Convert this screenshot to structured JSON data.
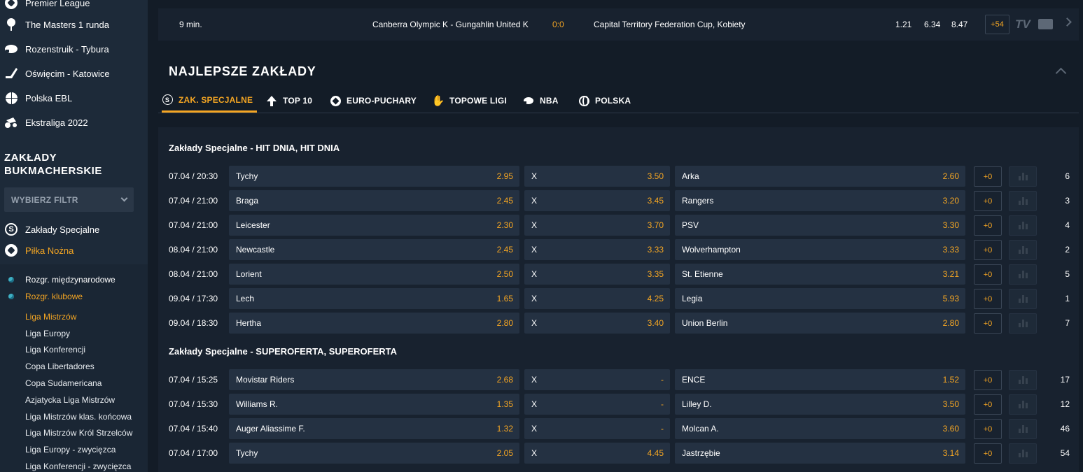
{
  "sidebar": {
    "top_items": [
      {
        "label": "Premier League",
        "icon": "soccer-ball-icon"
      },
      {
        "label": "The Masters 1 runda",
        "icon": "golf-icon"
      },
      {
        "label": "Rozenstruik - Tybura",
        "icon": "boxing-glove-icon"
      },
      {
        "label": "Oświęcim - Katowice",
        "icon": "hockey-stick-icon"
      },
      {
        "label": "Polska EBL",
        "icon": "basketball-icon"
      },
      {
        "label": "Ekstraliga 2022",
        "icon": "speedway-icon"
      }
    ],
    "heading": "ZAKŁADY BUKMACHERSKIE",
    "filter": {
      "label": "WYBIERZ FILTR"
    },
    "categories": [
      {
        "label": "Zakłady Specjalne",
        "icon": "special-s-icon"
      },
      {
        "label": "Piłka Nożna",
        "icon": "soccer-ball-icon"
      }
    ],
    "subcategories": [
      {
        "label": "Rozgr. międzynarodowe"
      },
      {
        "label": "Rozgr. klubowe"
      }
    ],
    "leagues": [
      "Liga Mistrzów",
      "Liga Europy",
      "Liga Konferencji",
      "Copa Libertadores",
      "Copa Sudamericana",
      "Azjatycka Liga Mistrzów",
      "Liga Mistrzów klas. końcowa",
      "Liga Mistrzów Król Strzelców",
      "Liga Europy - zwycięzca",
      "Liga Konferencji - zwycięzca"
    ]
  },
  "top_match": {
    "time": "9 min.",
    "teams": "Canberra Olympic K - Gungahlin United K",
    "score": "0:0",
    "competition": "Capital Territory Federation Cup, Kobiety",
    "odds": [
      "1.21",
      "6.34",
      "8.47"
    ],
    "more": "+54",
    "tv": "TV"
  },
  "section": {
    "title": "NAJLEPSZE ZAKŁADY"
  },
  "tabs": [
    {
      "label": "ZAK. SPECJALNE",
      "icon": "special-s-icon"
    },
    {
      "label": "TOP 10",
      "icon": "arrow-up-icon"
    },
    {
      "label": "EURO-PUCHARY",
      "icon": "soccer-ball-icon"
    },
    {
      "label": "TOPOWE LIGI",
      "icon": "hand-icon"
    },
    {
      "label": "NBA",
      "icon": "basketball-icon"
    },
    {
      "label": "POLSKA",
      "icon": "globe-icon"
    }
  ],
  "groups": [
    {
      "title": "Zakłady Specjalne - HIT DNIA, HIT DNIA",
      "rows": [
        {
          "time": "07.04 / 20:30",
          "home": "Tychy",
          "home_odd": "2.95",
          "draw": "X",
          "draw_odd": "3.50",
          "away": "Arka",
          "away_odd": "2.60",
          "plus": "+0",
          "count": "6"
        },
        {
          "time": "07.04 / 21:00",
          "home": "Braga",
          "home_odd": "2.45",
          "draw": "X",
          "draw_odd": "3.45",
          "away": "Rangers",
          "away_odd": "3.20",
          "plus": "+0",
          "count": "3"
        },
        {
          "time": "07.04 / 21:00",
          "home": "Leicester",
          "home_odd": "2.30",
          "draw": "X",
          "draw_odd": "3.70",
          "away": "PSV",
          "away_odd": "3.30",
          "plus": "+0",
          "count": "4"
        },
        {
          "time": "08.04 / 21:00",
          "home": "Newcastle",
          "home_odd": "2.45",
          "draw": "X",
          "draw_odd": "3.33",
          "away": "Wolverhampton",
          "away_odd": "3.33",
          "plus": "+0",
          "count": "2"
        },
        {
          "time": "08.04 / 21:00",
          "home": "Lorient",
          "home_odd": "2.50",
          "draw": "X",
          "draw_odd": "3.35",
          "away": "St. Etienne",
          "away_odd": "3.21",
          "plus": "+0",
          "count": "5"
        },
        {
          "time": "09.04 / 17:30",
          "home": "Lech",
          "home_odd": "1.65",
          "draw": "X",
          "draw_odd": "4.25",
          "away": "Legia",
          "away_odd": "5.93",
          "plus": "+0",
          "count": "1"
        },
        {
          "time": "09.04 / 18:30",
          "home": "Hertha",
          "home_odd": "2.80",
          "draw": "X",
          "draw_odd": "3.40",
          "away": "Union Berlin",
          "away_odd": "2.80",
          "plus": "+0",
          "count": "7"
        }
      ]
    },
    {
      "title": "Zakłady Specjalne - SUPEROFERTA, SUPEROFERTA",
      "rows": [
        {
          "time": "07.04 / 15:25",
          "home": "Movistar Riders",
          "home_odd": "2.68",
          "draw": "X",
          "draw_odd": "-",
          "away": "ENCE",
          "away_odd": "1.52",
          "plus": "+0",
          "count": "17"
        },
        {
          "time": "07.04 / 15:30",
          "home": "Williams R.",
          "home_odd": "1.35",
          "draw": "X",
          "draw_odd": "-",
          "away": "Lilley D.",
          "away_odd": "3.50",
          "plus": "+0",
          "count": "12"
        },
        {
          "time": "07.04 / 15:40",
          "home": "Auger Aliassime F.",
          "home_odd": "1.32",
          "draw": "X",
          "draw_odd": "-",
          "away": "Molcan A.",
          "away_odd": "3.60",
          "plus": "+0",
          "count": "46"
        },
        {
          "time": "07.04 / 17:00",
          "home": "Tychy",
          "home_odd": "2.05",
          "draw": "X",
          "draw_odd": "4.45",
          "away": "Jastrzębie",
          "away_odd": "3.14",
          "plus": "+0",
          "count": "54"
        }
      ]
    }
  ],
  "colors": {
    "accent": "#f5a623",
    "sidebar_bg": "#1d2a39",
    "main_bg": "#131c27",
    "cell_bg": "#243142"
  }
}
